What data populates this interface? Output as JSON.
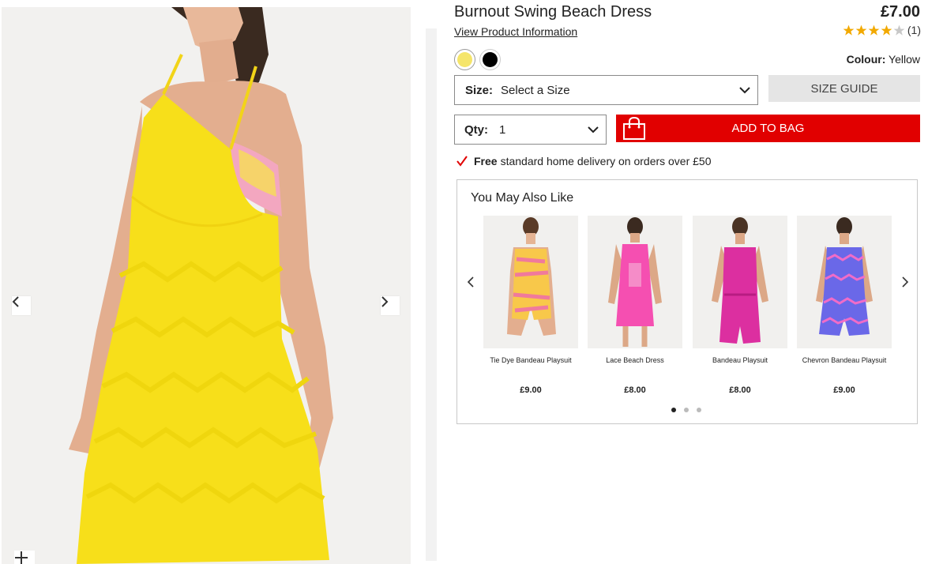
{
  "product": {
    "title": "Burnout Swing Beach Dress",
    "view_info_label": "View Product Information",
    "price": "£7.00",
    "rating_stars": 4,
    "rating_max": 5,
    "rating_count": "(1)",
    "colour_label": "Colour:",
    "colour_value": "Yellow",
    "swatches": [
      {
        "name": "Yellow",
        "color": "#f5e56a"
      },
      {
        "name": "Black",
        "color": "#000000"
      }
    ]
  },
  "size": {
    "label": "Size:",
    "placeholder": "Select a Size",
    "guide_label": "SIZE GUIDE"
  },
  "qty": {
    "label": "Qty:",
    "value": "1"
  },
  "add_to_bag_label": "ADD TO BAG",
  "delivery": {
    "bold": "Free",
    "text": "standard home delivery on orders over £50"
  },
  "you_may_also_like": {
    "title": "You May Also Like",
    "items": [
      {
        "name": "Tie Dye Bandeau Playsuit",
        "price": "£9.00"
      },
      {
        "name": "Lace Beach Dress",
        "price": "£8.00"
      },
      {
        "name": "Bandeau Playsuit",
        "price": "£8.00"
      },
      {
        "name": "Chevron Bandeau Playsuit",
        "price": "£9.00"
      }
    ],
    "page_count": 3,
    "active_page": 1
  },
  "colors": {
    "accent_red": "#e10000",
    "star_gold": "#f2a900",
    "dress_yellow": "#f7df1a"
  }
}
